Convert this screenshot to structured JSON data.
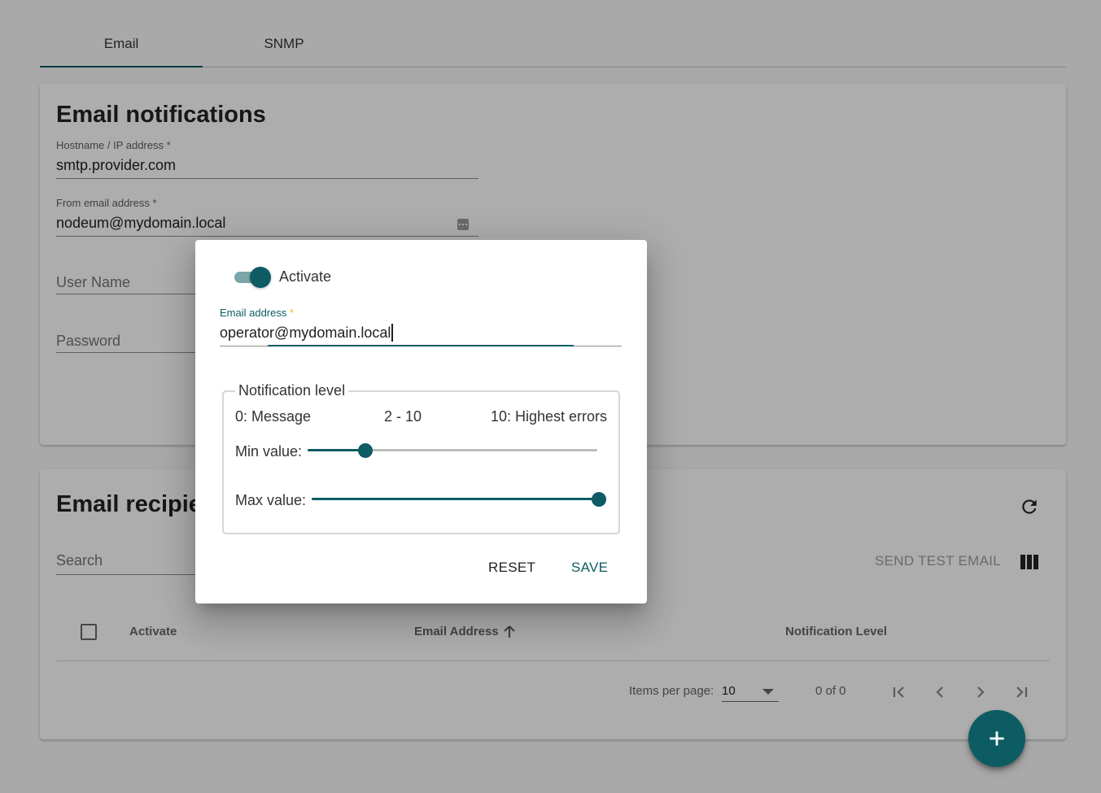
{
  "tabs": [
    {
      "label": "Email",
      "active": true
    },
    {
      "label": "SNMP",
      "active": false
    }
  ],
  "email_card": {
    "title": "Email notifications",
    "hostname": {
      "label": "Hostname / IP address *",
      "value": "smtp.provider.com"
    },
    "from_email": {
      "label": "From email address *",
      "value": "nodeum@mydomain.local"
    },
    "user_name": {
      "placeholder": "User Name"
    },
    "password": {
      "placeholder": "Password"
    }
  },
  "recipients_card": {
    "title": "Email recipients",
    "search_placeholder": "Search",
    "send_test_label": "SEND TEST EMAIL",
    "columns": [
      "Activate",
      "Email Address",
      "Notification Level"
    ],
    "paginator": {
      "items_per_page_label": "Items per page:",
      "items_per_page": "10",
      "range": "0 of 0"
    }
  },
  "dialog": {
    "activate_label": "Activate",
    "activate_on": true,
    "email_label": "Email address",
    "email_required": "*",
    "email_value": "operator@mydomain.local",
    "notification": {
      "legend": "Notification level",
      "min_scale": "0: Message",
      "range_text": "2 - 10",
      "max_scale": "10: Highest errors",
      "min_label": "Min value:",
      "max_label": "Max value:",
      "scale_min": 0,
      "scale_max": 10,
      "min_value": 2,
      "max_value": 10
    },
    "reset_label": "RESET",
    "save_label": "SAVE"
  },
  "colors": {
    "primary": "#0d5c63",
    "accent": "#f5c000"
  },
  "icons": [
    "refresh-icon",
    "columns-icon",
    "sort-arrow-up-icon",
    "first-page-icon",
    "prev-page-icon",
    "next-page-icon",
    "last-page-icon",
    "add-icon",
    "dropdown-caret-icon"
  ]
}
